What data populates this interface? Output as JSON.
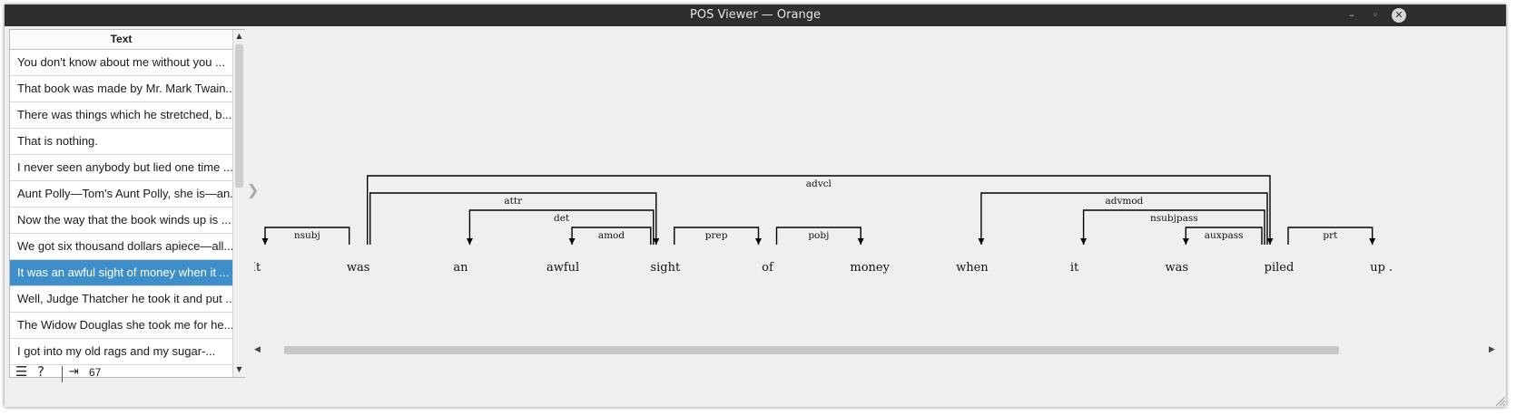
{
  "window": {
    "title": "POS Viewer — Orange",
    "minimize_glyph": "–",
    "maximize_glyph": "◦",
    "close_glyph": "✕"
  },
  "list": {
    "header": "Text",
    "rows": [
      "You don't know about me without you ...",
      "That book was made by Mr. Mark Twain...",
      "There was things which he stretched, b...",
      "That is nothing.",
      "I never seen anybody but lied one time ...",
      "Aunt Polly—Tom's Aunt Polly, she is—an...",
      "Now the way that the book winds up is ...",
      "We got six thousand dollars apiece—all...",
      "It was an awful sight of money when it ...",
      "Well, Judge Thatcher he took it and put ...",
      "The Widow Douglas she took me for he...",
      "I got into my old rags and my sugar-..."
    ],
    "selected_index": 8
  },
  "statusbar": {
    "menu_icon": "hamburger-menu-icon",
    "help_icon": "help-question-icon",
    "input_icon": "input-data-icon",
    "count": "67"
  },
  "dependency": {
    "tokens": [
      "It",
      "was",
      "an",
      "awful",
      "sight",
      "of",
      "money",
      "when",
      "it",
      "was",
      "piled",
      "up ."
    ],
    "arcs": [
      {
        "label": "nsubj",
        "head": 1,
        "dep": 0
      },
      {
        "label": "advcl",
        "head": 1,
        "dep": 10
      },
      {
        "label": "attr",
        "head": 1,
        "dep": 4
      },
      {
        "label": "attr",
        "head": 4,
        "dep": 2,
        "display": "det"
      },
      {
        "label": "amod",
        "head": 4,
        "dep": 3
      },
      {
        "label": "prep",
        "head": 4,
        "dep": 5
      },
      {
        "label": "pobj",
        "head": 5,
        "dep": 6
      },
      {
        "label": "advmod",
        "head": 10,
        "dep": 7
      },
      {
        "label": "nsubjpass",
        "head": 10,
        "dep": 8
      },
      {
        "label": "auxpass",
        "head": 10,
        "dep": 9
      },
      {
        "label": "prt",
        "head": 10,
        "dep": 11
      }
    ]
  },
  "colors": {
    "selected_row": "#3d8ec9",
    "titlebar": "#2e2e2e",
    "arc_stroke": "#000000"
  }
}
